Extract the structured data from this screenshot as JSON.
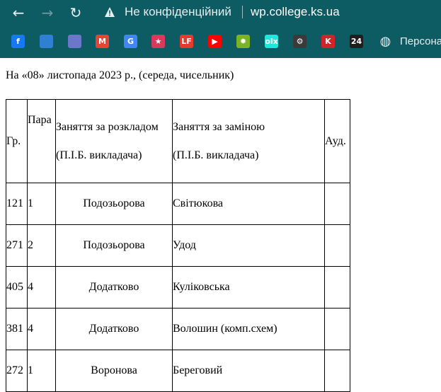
{
  "browser": {
    "security_label": "Не конфіденційний",
    "url": "wp.college.ks.ua",
    "nav": {
      "back": "←",
      "forward": "→",
      "reload": "↻"
    },
    "bookmarks": [
      {
        "icon": "facebook-icon",
        "text": "f",
        "color": "#1877f2"
      },
      {
        "icon": "bookmark-blue-icon",
        "text": "",
        "color": "#2f7fd3"
      },
      {
        "icon": "crest-icon",
        "text": "",
        "color": "#6b78c9"
      },
      {
        "icon": "gmail-icon",
        "text": "M",
        "color": "#ea4335"
      },
      {
        "icon": "translate-icon",
        "text": "G",
        "color": "#4285f4"
      },
      {
        "icon": "star-icon",
        "text": "★",
        "color": "#d73b5c"
      },
      {
        "icon": "lf-icon",
        "text": "LF",
        "color": "#e43c2b"
      },
      {
        "icon": "youtube-icon",
        "text": "▶",
        "color": "#ff0000"
      },
      {
        "icon": "gear-green-icon",
        "text": "✹",
        "color": "#7bb328"
      },
      {
        "icon": "olx-icon",
        "text": "olx",
        "color": "#23e5db"
      },
      {
        "icon": "settings-dark-icon",
        "text": "⚙",
        "color": "#3a3a3a"
      },
      {
        "icon": "k-icon",
        "text": "K",
        "color": "#d2232a"
      },
      {
        "icon": "24-icon",
        "text": "24",
        "color": "#1e1e1e"
      },
      {
        "icon": "globe-icon",
        "text": "◍",
        "color": "#0d5b63"
      }
    ],
    "bookmark_label": "Персона"
  },
  "page": {
    "header": "На «08» листопада 2023 р., (середа, чисельник)"
  },
  "table": {
    "headers": {
      "group": "Гр.",
      "pair": "Пара",
      "scheduled_line1": "Заняття за розкладом",
      "scheduled_line2": "(П.І.Б. викладача)",
      "replacement_line1": "Заняття за заміною",
      "replacement_line2": "(П.І.Б. викладача)",
      "room": "Ауд."
    },
    "rows": [
      {
        "group": "121",
        "pair": "1",
        "scheduled": "Подозьорова",
        "replacement": "Світюкова",
        "room": ""
      },
      {
        "group": "271",
        "pair": "2",
        "scheduled": "Подозьорова",
        "replacement": "Удод",
        "room": ""
      },
      {
        "group": "405",
        "pair": "4",
        "scheduled": "Додатково",
        "replacement": "Куліковська",
        "room": ""
      },
      {
        "group": "381",
        "pair": "4",
        "scheduled": "Додатково",
        "replacement": "Волошин (комп.схем)",
        "room": ""
      },
      {
        "group": "272",
        "pair": "1",
        "scheduled": "Воронова",
        "replacement": "Береговий",
        "room": ""
      }
    ]
  }
}
